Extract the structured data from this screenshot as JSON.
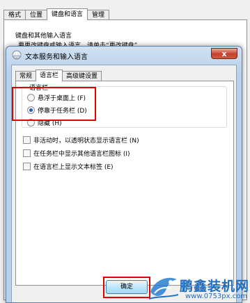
{
  "background_dialog": {
    "tabs": [
      "格式",
      "位置",
      "键盘和语言",
      "管理"
    ],
    "active_tab": 2,
    "group_title": "键盘和其他输入语言",
    "cut_text": "要更改键盘或输入语言，请单击“更改键盘”"
  },
  "dialog": {
    "title": "文本服务和输入语言",
    "close_label": "x",
    "tabs": [
      "常规",
      "语言栏",
      "高级键设置"
    ],
    "active_tab": 1,
    "language_bar": {
      "group_label": "语言栏",
      "options": [
        {
          "label": "悬浮于桌面上 (F)",
          "selected": false
        },
        {
          "label": "停靠于任务栏 (D)",
          "selected": true
        },
        {
          "label": "隐藏 (H)",
          "selected": false
        }
      ]
    },
    "checkboxes": [
      {
        "label": "非活动时，以透明状态显示语言栏 (N)",
        "checked": false
      },
      {
        "label": "在任务栏中显示其他语言栏图标 (I)",
        "checked": false
      },
      {
        "label": "在语言栏上显示文本标签 (E)",
        "checked": false
      }
    ],
    "ok_label": "确定"
  },
  "watermark": {
    "title": "鹏鑫装机网",
    "url": "www.0753px.com"
  },
  "colors": {
    "highlight": "#e00000",
    "watermark": "#1d6ec0",
    "radio_dot": "#1f5fb4"
  }
}
